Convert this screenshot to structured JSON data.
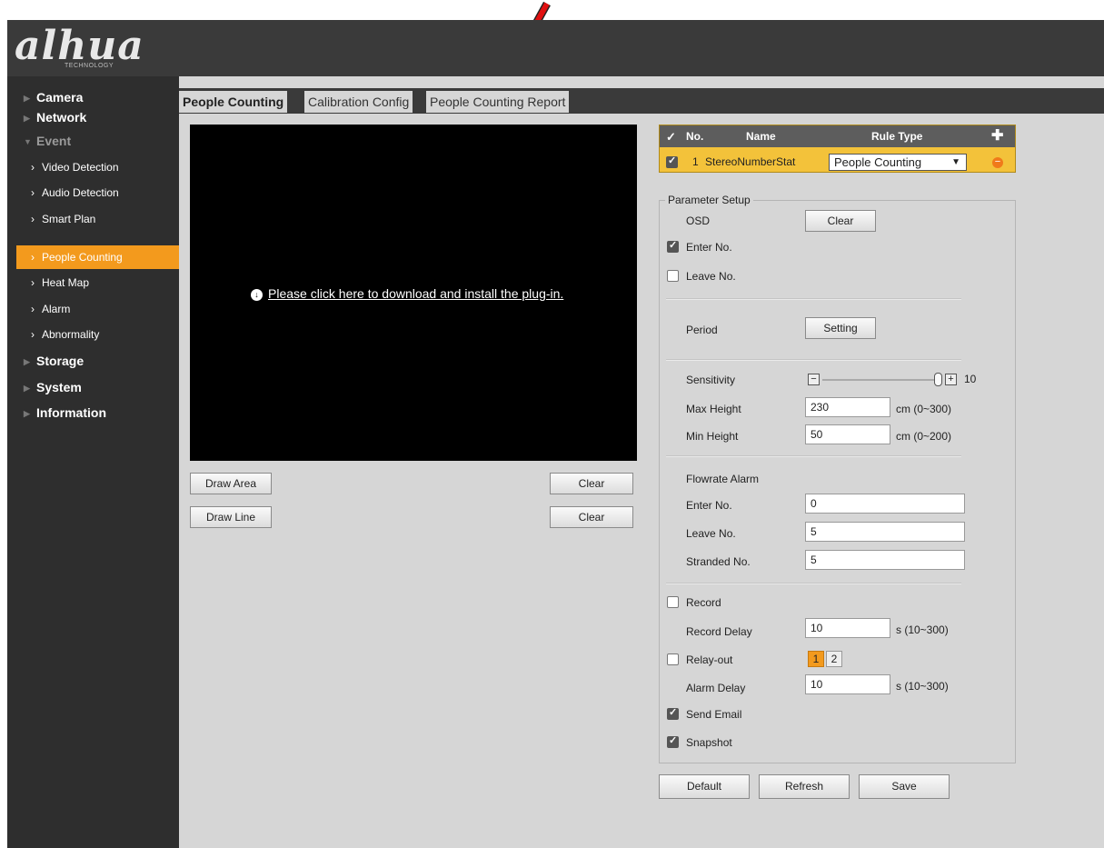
{
  "brand": {
    "logo": "alhua",
    "sub": "TECHNOLOGY"
  },
  "sidebar": {
    "items": [
      {
        "label": "Camera"
      },
      {
        "label": "Network"
      },
      {
        "label": "Event"
      },
      {
        "label": "Video Detection"
      },
      {
        "label": "Audio Detection"
      },
      {
        "label": "Smart Plan"
      },
      {
        "label": "People Counting"
      },
      {
        "label": "Heat Map"
      },
      {
        "label": "Alarm"
      },
      {
        "label": "Abnormality"
      },
      {
        "label": "Storage"
      },
      {
        "label": "System"
      },
      {
        "label": "Information"
      }
    ]
  },
  "tabs": [
    {
      "label": "People Counting"
    },
    {
      "label": "Calibration Config"
    },
    {
      "label": "People Counting Report"
    }
  ],
  "video": {
    "plugin_text": "Please click here to download and install the plug-in."
  },
  "draw": {
    "area": "Draw Area",
    "line": "Draw Line",
    "clear": "Clear"
  },
  "rule_table": {
    "headers": {
      "no": "No.",
      "name": "Name",
      "type": "Rule Type"
    },
    "row": {
      "no": "1",
      "name": "StereoNumberStat",
      "type": "People Counting"
    }
  },
  "params": {
    "legend": "Parameter Setup",
    "osd": "OSD",
    "clear": "Clear",
    "enter_no": "Enter No.",
    "leave_no": "Leave No.",
    "period": "Period",
    "setting": "Setting",
    "sensitivity": "Sensitivity",
    "sensitivity_value": "10",
    "max_height": "Max Height",
    "max_height_value": "230",
    "max_height_range": "cm (0~300)",
    "min_height": "Min Height",
    "min_height_value": "50",
    "min_height_range": "cm (0~200)",
    "flowrate_alarm": "Flowrate Alarm",
    "flow_enter": "Enter No.",
    "flow_enter_value": "0",
    "flow_leave": "Leave No.",
    "flow_leave_value": "5",
    "stranded": "Stranded No.",
    "stranded_value": "5",
    "record": "Record",
    "record_delay": "Record Delay",
    "record_delay_value": "10",
    "record_delay_range": "s (10~300)",
    "relay_out": "Relay-out",
    "relay_1": "1",
    "relay_2": "2",
    "alarm_delay": "Alarm Delay",
    "alarm_delay_value": "10",
    "alarm_delay_range": "s (10~300)",
    "send_email": "Send Email",
    "snapshot": "Snapshot"
  },
  "actions": {
    "default": "Default",
    "refresh": "Refresh",
    "save": "Save"
  },
  "colors": {
    "accent": "#f39a1d",
    "sidebar": "#2e2e2e",
    "header": "#3a3a3a",
    "annotation_arrow": "#e01010"
  }
}
